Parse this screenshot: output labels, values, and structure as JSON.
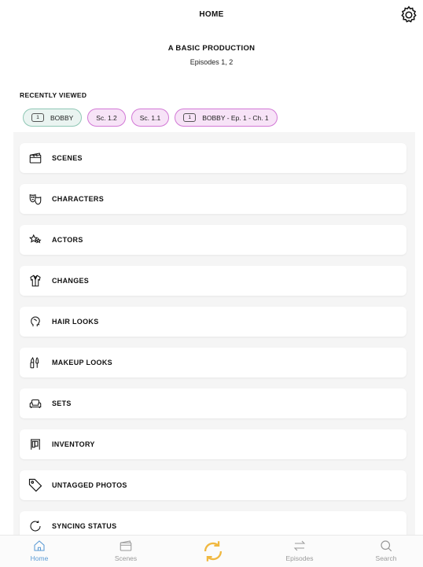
{
  "header": {
    "title": "HOME"
  },
  "production": {
    "title": "A BASIC PRODUCTION",
    "episodes": "Episodes 1, 2"
  },
  "recently_viewed": {
    "label": "RECENTLY VIEWED",
    "chips": [
      {
        "badge": "1",
        "label": "BOBBY",
        "style": "green"
      },
      {
        "label": "Sc. 1.2",
        "style": "pink"
      },
      {
        "label": "Sc. 1.1",
        "style": "pink"
      },
      {
        "badge": "1",
        "label": "BOBBY - Ep. 1 - Ch. 1",
        "style": "pink"
      }
    ]
  },
  "menu": [
    {
      "label": "SCENES",
      "icon": "clapperboard-icon"
    },
    {
      "label": "CHARACTERS",
      "icon": "theater-masks-icon"
    },
    {
      "label": "ACTORS",
      "icon": "stars-icon"
    },
    {
      "label": "CHANGES",
      "icon": "jacket-icon"
    },
    {
      "label": "HAIR LOOKS",
      "icon": "head-hair-icon"
    },
    {
      "label": "MAKEUP LOOKS",
      "icon": "makeup-brushes-icon"
    },
    {
      "label": "SETS",
      "icon": "sofa-icon"
    },
    {
      "label": "INVENTORY",
      "icon": "clothes-rack-icon"
    },
    {
      "label": "UNTAGGED PHOTOS",
      "icon": "tag-icon"
    },
    {
      "label": "SYNCING STATUS",
      "icon": "refresh-icon"
    }
  ],
  "tabbar": {
    "home": "Home",
    "scenes": "Scenes",
    "episodes": "Episodes",
    "search": "Search"
  },
  "colors": {
    "accent": "#5b9bd5",
    "sync": "#f0b840",
    "chip_green_border": "#8fc7b5",
    "chip_pink_border": "#d279d6"
  }
}
